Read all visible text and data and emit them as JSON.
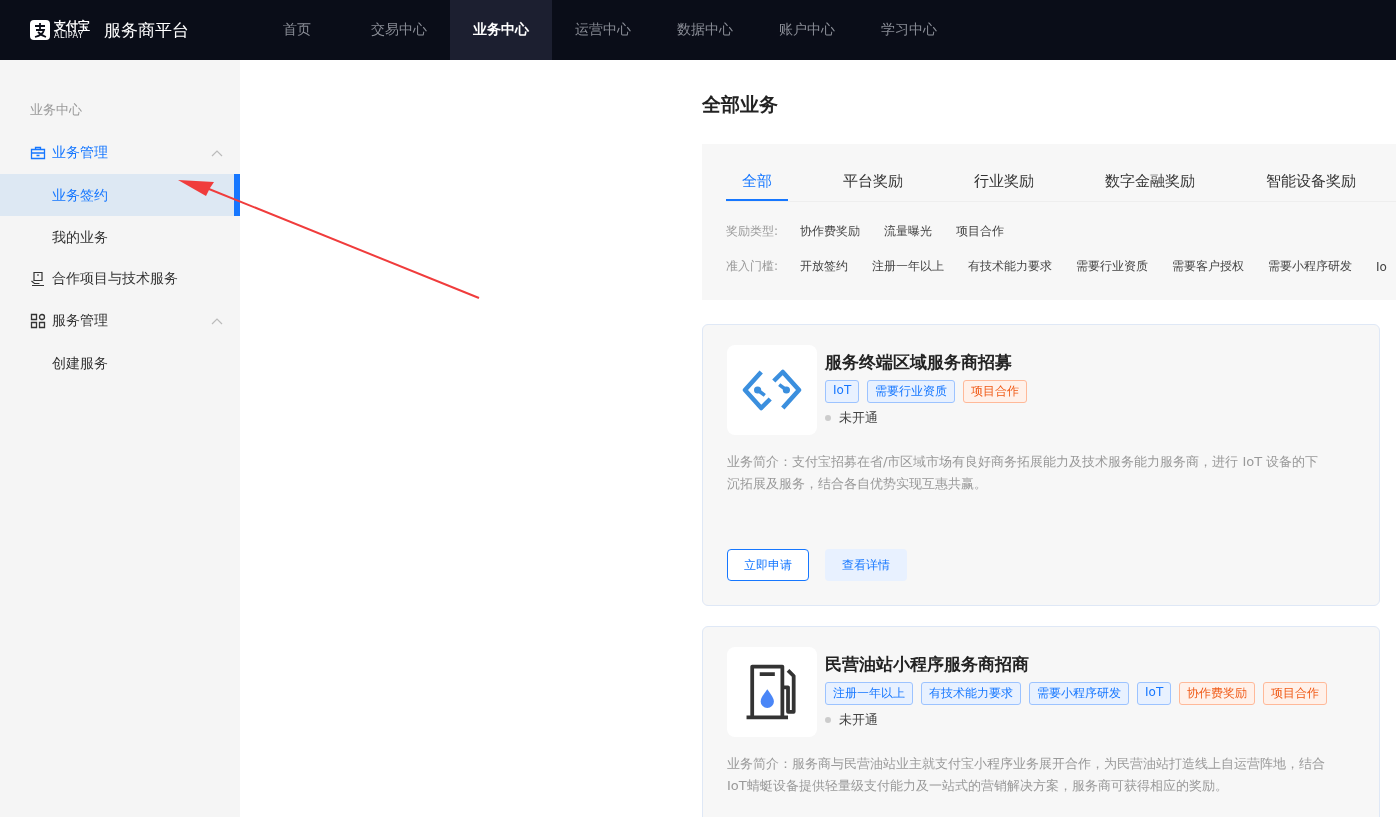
{
  "brand": {
    "logo_text": "支付宝",
    "logo_sub": "ALIPAY",
    "title": "服务商平台"
  },
  "nav": [
    {
      "label": "首页",
      "selected": false
    },
    {
      "label": "交易中心",
      "selected": false
    },
    {
      "label": "业务中心",
      "selected": true
    },
    {
      "label": "运营中心",
      "selected": false
    },
    {
      "label": "数据中心",
      "selected": false
    },
    {
      "label": "账户中心",
      "selected": false
    },
    {
      "label": "学习中心",
      "selected": false
    }
  ],
  "sidebar": {
    "heading": "业务中心",
    "groups": [
      {
        "label": "业务管理",
        "kind": "briefcase",
        "expanded": true,
        "active": true,
        "children": [
          {
            "label": "业务签约",
            "selected": true
          },
          {
            "label": "我的业务",
            "selected": false
          }
        ]
      },
      {
        "label": "合作项目与技术服务",
        "kind": "service"
      },
      {
        "label": "服务管理",
        "kind": "grid",
        "expanded": true,
        "active": false,
        "children": [
          {
            "label": "创建服务",
            "selected": false
          }
        ]
      }
    ]
  },
  "page_title": "全部业务",
  "category_tabs": [
    {
      "label": "全部",
      "selected": true
    },
    {
      "label": "平台奖励",
      "selected": false
    },
    {
      "label": "行业奖励",
      "selected": false
    },
    {
      "label": "数字金融奖励",
      "selected": false
    },
    {
      "label": "智能设备奖励",
      "selected": false
    }
  ],
  "filters": [
    {
      "label": "奖励类型:",
      "options": [
        "协作费奖励",
        "流量曝光",
        "项目合作"
      ]
    },
    {
      "label": "准入门槛:",
      "options": [
        "开放签约",
        "注册一年以上",
        "有技术能力要求",
        "需要行业资质",
        "需要客户授权",
        "需要小程序研发",
        "Io"
      ]
    }
  ],
  "cards": [
    {
      "kind": "link",
      "title": "服务终端区域服务商招募",
      "tags": [
        {
          "label": "IoT",
          "kind": "blue"
        },
        {
          "label": "需要行业资质",
          "kind": "blue"
        },
        {
          "label": "项目合作",
          "kind": "orange"
        }
      ],
      "status": "未开通",
      "description": "业务简介：支付宝招募在省/市区域市场有良好商务拓展能力及技术服务能力服务商，进行 IoT 设备的下沉拓展及服务，结合各自优势实现互惠共赢。",
      "buttons": [
        {
          "label": "立即申请",
          "kind": "primary"
        },
        {
          "label": "查看详情",
          "kind": "secondary"
        }
      ]
    },
    {
      "kind": "fuel",
      "title": "民营油站小程序服务商招商",
      "tags": [
        {
          "label": "注册一年以上",
          "kind": "blue"
        },
        {
          "label": "有技术能力要求",
          "kind": "blue"
        },
        {
          "label": "需要小程序研发",
          "kind": "blue"
        },
        {
          "label": "IoT",
          "kind": "blue"
        },
        {
          "label": "协作费奖励",
          "kind": "orange"
        },
        {
          "label": "项目合作",
          "kind": "orange"
        }
      ],
      "status": "未开通",
      "description": "业务简介：服务商与民营油站业主就支付宝小程序业务展开合作，为民营油站打造线上自运营阵地，结合IoT蜻蜓设备提供轻量级支付能力及一站式的营销解决方案，服务商可获得相应的奖励。"
    }
  ]
}
